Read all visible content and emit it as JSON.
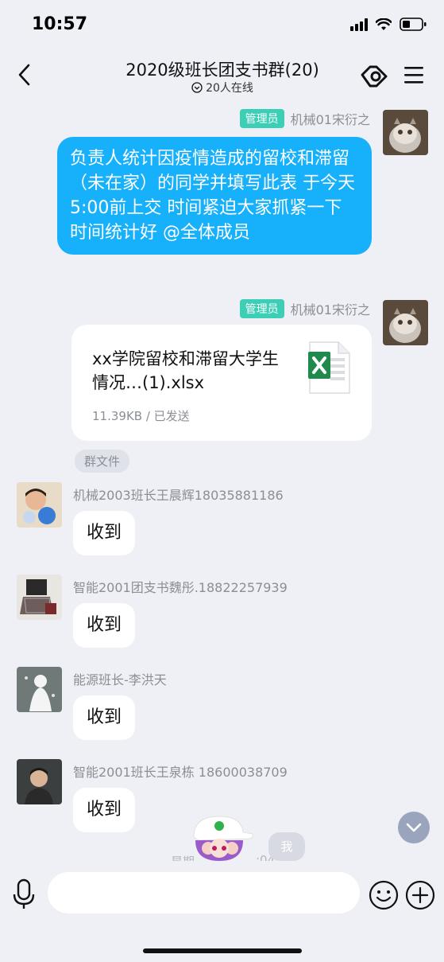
{
  "status_bar": {
    "time": "10:57"
  },
  "header": {
    "title": "2020级班长团支书群(20)",
    "online": "20人在线"
  },
  "messages": {
    "m1": {
      "badge": "管理员",
      "sender": "机械01宋衍之",
      "text": "负责人统计因疫情造成的留校和滞留（未在家）的同学并填写此表 于今天5:00前上交  时间紧迫大家抓紧一下时间统计好 @全体成员"
    },
    "m2": {
      "badge": "管理员",
      "sender": "机械01宋衍之",
      "file_name": "xx学院留校和滞留大学生情况…(1).xlsx",
      "file_meta": "11.39KB / 已发送",
      "tag": "群文件"
    },
    "m3": {
      "sender": "机械2003班长王晨辉18035881186",
      "text": "收到"
    },
    "m4": {
      "sender": "智能2001团支书魏彤.18822257939",
      "text": "收到"
    },
    "m5": {
      "sender": "能源班长-李洪天",
      "text": "收到"
    },
    "m6": {
      "sender": "智能2001班长王泉栋 18600038709",
      "text": "收到"
    }
  },
  "me_badge": "我",
  "date_fragment_left": "星期",
  "date_fragment_right": ":04",
  "icons": [
    "back-icon",
    "share-link-icon",
    "menu-icon",
    "microphone-icon",
    "emoji-icon",
    "add-icon",
    "excel-file-icon",
    "scroll-down-icon"
  ]
}
